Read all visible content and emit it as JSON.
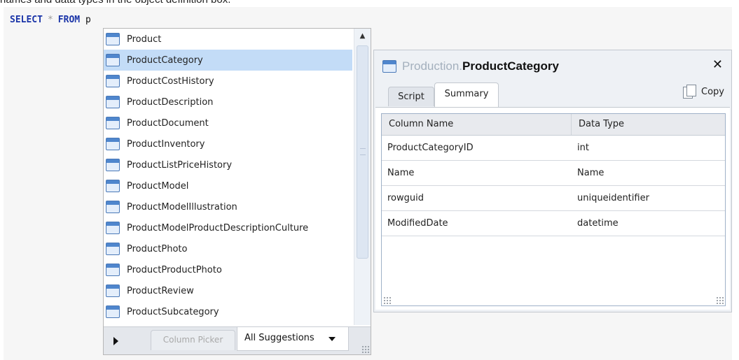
{
  "caption": "names and data types in the object definition box.",
  "editor": {
    "keyword_select": "SELECT",
    "operator": "*",
    "keyword_from": "FROM",
    "typed_text": "p"
  },
  "suggestions": {
    "selected_index": 1,
    "items": [
      "Product",
      "ProductCategory",
      "ProductCostHistory",
      "ProductDescription",
      "ProductDocument",
      "ProductInventory",
      "ProductListPriceHistory",
      "ProductModel",
      "ProductModelIllustration",
      "ProductModelProductDescriptionCulture",
      "ProductPhoto",
      "ProductProductPhoto",
      "ProductReview",
      "ProductSubcategory"
    ],
    "footer": {
      "column_picker_label": "Column Picker",
      "all_suggestions_label": "All Suggestions"
    }
  },
  "definition": {
    "schema": "Production",
    "separator": ".",
    "object_name": "ProductCategory",
    "close_label": "✕",
    "tabs": {
      "script_label": "Script",
      "summary_label": "Summary",
      "active": "Summary"
    },
    "copy_label": "Copy",
    "columns_header": [
      "Column Name",
      "Data Type"
    ],
    "rows": [
      {
        "name": "ProductCategoryID",
        "type": "int"
      },
      {
        "name": "Name",
        "type": "Name"
      },
      {
        "name": "rowguid",
        "type": "uniqueidentifier"
      },
      {
        "name": "ModifiedDate",
        "type": "datetime"
      }
    ]
  },
  "colors": {
    "keyword": "#1a34a8",
    "selection": "#c3dcf7",
    "table_icon": "#4f86cd"
  },
  "icons": [
    "table-icon",
    "scroll-up-arrow-icon",
    "expand-arrow-icon",
    "dropdown-caret-icon",
    "close-icon",
    "copy-icon",
    "resize-grip-icon"
  ]
}
